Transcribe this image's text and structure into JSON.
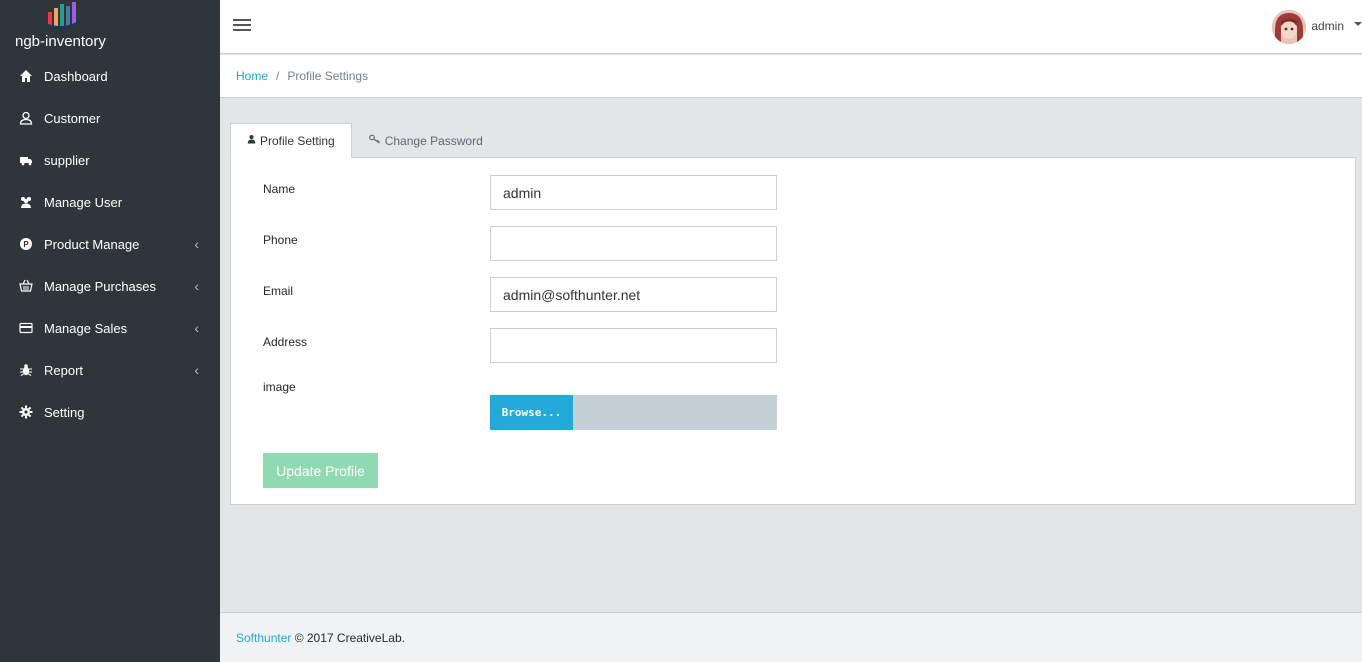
{
  "brand": {
    "name": "ngb-inventory",
    "logo_icon": "bar-chart-logo"
  },
  "sidebar": {
    "items": [
      {
        "label": "Dashboard",
        "icon": "home-icon",
        "has_submenu": false
      },
      {
        "label": "Customer",
        "icon": "user-icon",
        "has_submenu": false
      },
      {
        "label": "supplier",
        "icon": "truck-icon",
        "has_submenu": false
      },
      {
        "label": "Manage User",
        "icon": "users-icon",
        "has_submenu": false
      },
      {
        "label": "Product Manage",
        "icon": "product-icon",
        "has_submenu": true
      },
      {
        "label": "Manage Purchases",
        "icon": "basket-icon",
        "has_submenu": true
      },
      {
        "label": "Manage Sales",
        "icon": "credit-card-icon",
        "has_submenu": true
      },
      {
        "label": "Report",
        "icon": "bug-icon",
        "has_submenu": true
      },
      {
        "label": "Setting",
        "icon": "gear-icon",
        "has_submenu": false
      }
    ],
    "caret": "‹"
  },
  "header": {
    "user_name": "admin"
  },
  "breadcrumb": {
    "home": "Home",
    "separator": "/",
    "current": "Profile Settings"
  },
  "tabs": [
    {
      "label": "Profile Setting",
      "icon": "user-icon",
      "active": true
    },
    {
      "label": "Change Password",
      "icon": "key-icon",
      "active": false
    }
  ],
  "form": {
    "name": {
      "label": "Name",
      "value": "admin"
    },
    "phone": {
      "label": "Phone",
      "value": ""
    },
    "email": {
      "label": "Email",
      "value": "admin@softhunter.net"
    },
    "address": {
      "label": "Address",
      "value": ""
    },
    "image": {
      "label": "image",
      "browse_label": "Browse..."
    },
    "submit_label": "Update Profile"
  },
  "footer": {
    "link": "Softhunter",
    "text": " © 2017 CreativeLab."
  },
  "colors": {
    "sidebar": "#2f353a",
    "accent": "#20a8d8",
    "submit": "#8fdab1",
    "browse": "#23aad8"
  }
}
